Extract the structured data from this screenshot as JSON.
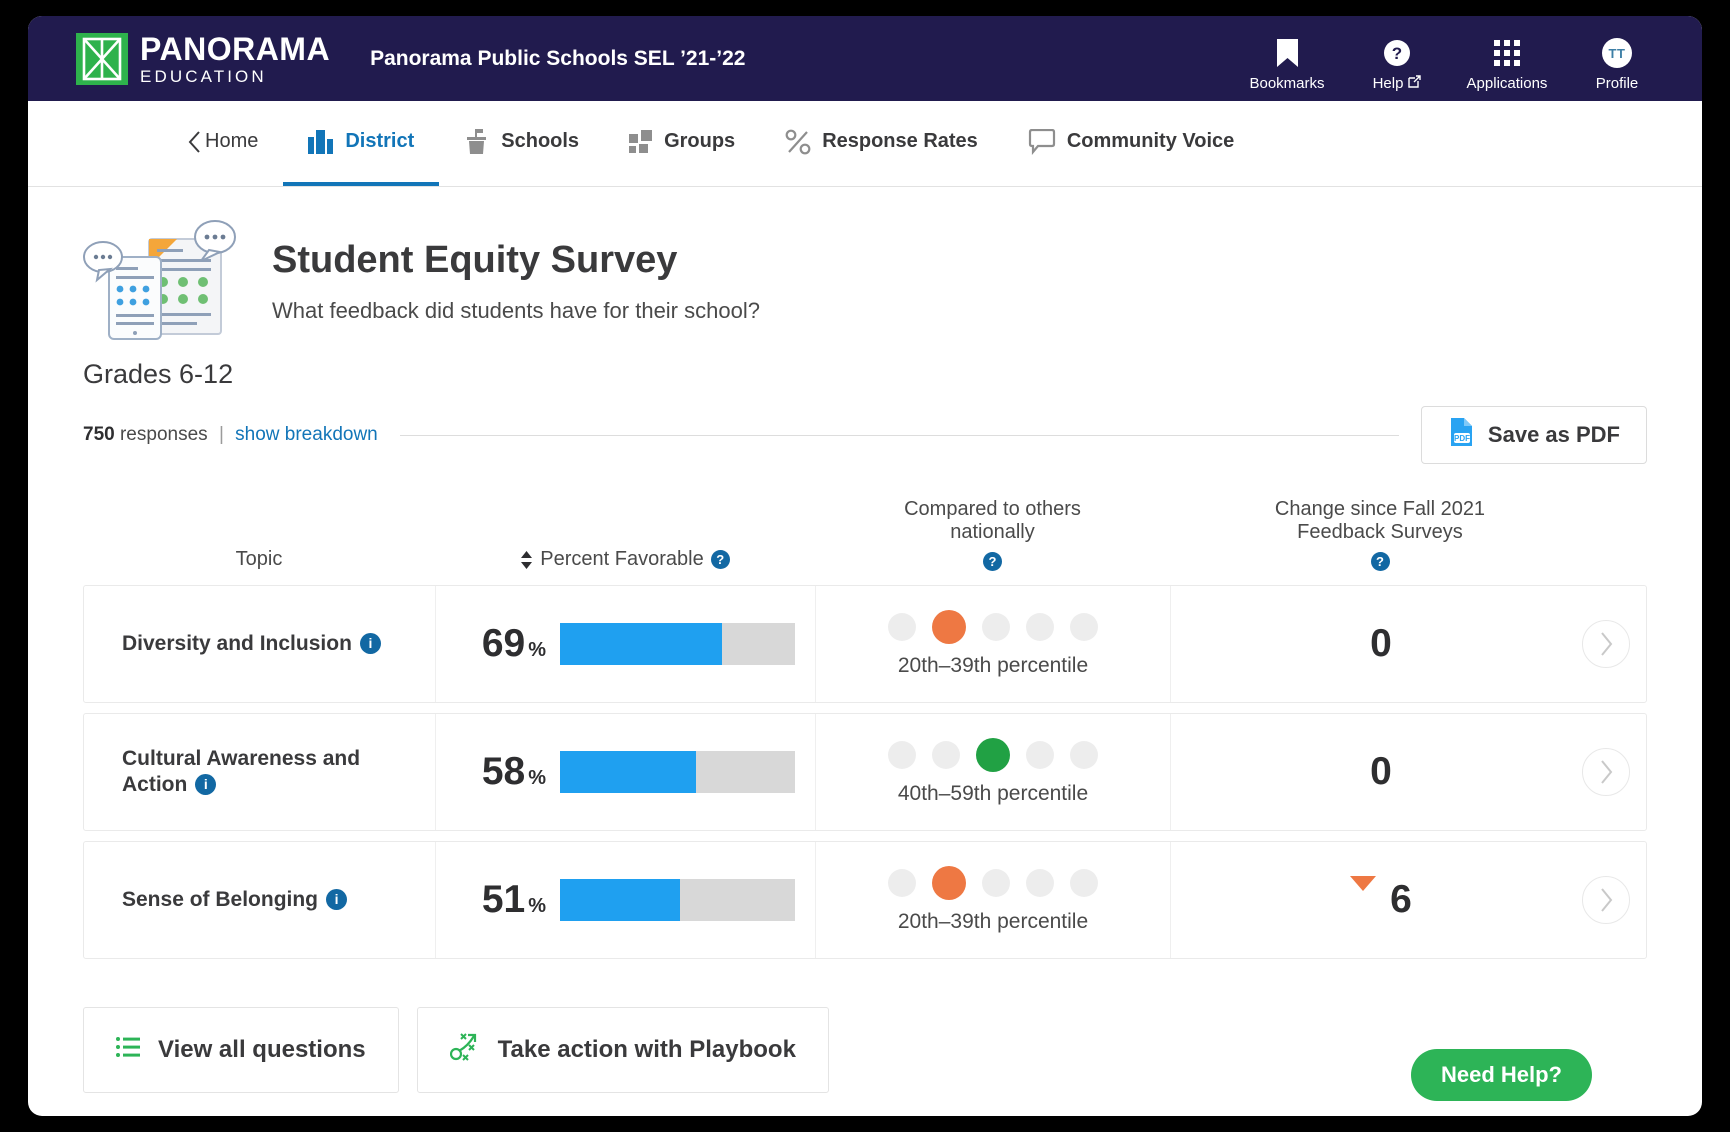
{
  "header": {
    "logo_name": "PANORAMA",
    "logo_sub": "EDUCATION",
    "site_title": "Panorama Public Schools SEL ’21-’22",
    "actions": [
      {
        "label": "Bookmarks",
        "icon": "bookmark-icon"
      },
      {
        "label": "Help",
        "icon": "help-circle-icon",
        "external": "↗"
      },
      {
        "label": "Applications",
        "icon": "grid-apps-icon"
      },
      {
        "label": "Profile",
        "icon": "avatar-icon",
        "initials": "TT"
      }
    ]
  },
  "nav": {
    "home_label": "Home",
    "tabs": [
      {
        "label": "District",
        "icon": "district-bars-icon",
        "active": true
      },
      {
        "label": "Schools",
        "icon": "school-building-icon",
        "active": false
      },
      {
        "label": "Groups",
        "icon": "groups-squares-icon",
        "active": false
      },
      {
        "label": "Response Rates",
        "icon": "percent-icon",
        "active": false
      },
      {
        "label": "Community Voice",
        "icon": "speech-bubble-icon",
        "active": false
      }
    ]
  },
  "survey": {
    "title": "Student Equity Survey",
    "subtitle": "What feedback did students have for their school?",
    "grades": "Grades 6-12",
    "response_count": "750",
    "response_word": "responses",
    "separator": "|",
    "breakdown_link": "show breakdown",
    "save_pdf_label": "Save as PDF"
  },
  "table": {
    "headers": {
      "topic": "Topic",
      "percent_favorable": "Percent Favorable",
      "compared_line1": "Compared to others",
      "compared_line2": "nationally",
      "change_line1": "Change since Fall 2021",
      "change_line2": "Feedback Surveys"
    },
    "rows": [
      {
        "topic": "Diversity and Inclusion",
        "percent": "69",
        "percent_symbol": "%",
        "bar_value": 69,
        "dots_total": 5,
        "dot_active_index": 1,
        "dot_color": "#EE7843",
        "percentile": "20th–39th percentile",
        "change": "0",
        "change_direction": "none"
      },
      {
        "topic": "Cultural Awareness and Action",
        "percent": "58",
        "percent_symbol": "%",
        "bar_value": 58,
        "dots_total": 5,
        "dot_active_index": 2,
        "dot_color": "#21A144",
        "percentile": "40th–59th percentile",
        "change": "0",
        "change_direction": "none"
      },
      {
        "topic": "Sense of Belonging",
        "percent": "51",
        "percent_symbol": "%",
        "bar_value": 51,
        "dots_total": 5,
        "dot_active_index": 1,
        "dot_color": "#EE7843",
        "percentile": "20th–39th percentile",
        "change": "6",
        "change_direction": "down"
      }
    ]
  },
  "footer": {
    "view_all_questions": "View all questions",
    "take_action": "Take action with Playbook",
    "need_help": "Need Help?"
  },
  "colors": {
    "brand_navy": "#211B4E",
    "brand_green": "#2EB24C",
    "accent_blue": "#1275B8",
    "bar_blue": "#1FA0F0",
    "orange": "#EE7843",
    "green_dot": "#21A144",
    "help_green": "#2DB457"
  }
}
